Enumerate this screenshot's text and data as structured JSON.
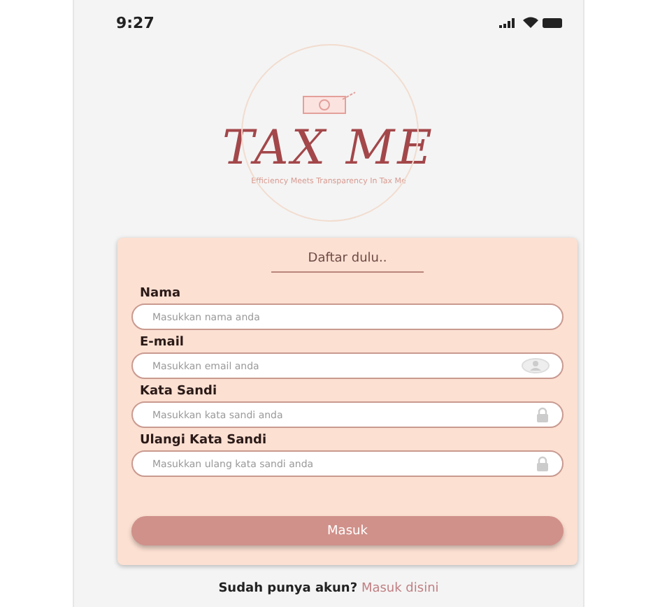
{
  "status_bar": {
    "time": "9:27"
  },
  "logo": {
    "title": "TAX ME",
    "tagline": "Efficiency Meets Transparency In Tax Me"
  },
  "form": {
    "heading": "Daftar dulu..",
    "fields": [
      {
        "label": "Nama",
        "placeholder": "Masukkan nama anda",
        "kind": "text"
      },
      {
        "label": "E-mail",
        "placeholder": "Masukkan email anda",
        "kind": "email"
      },
      {
        "label": "Kata Sandi",
        "placeholder": "Masukkan kata sandi anda",
        "kind": "password"
      },
      {
        "label": "Ulangi Kata Sandi",
        "placeholder": "Masukkan ulang kata sandi anda",
        "kind": "password"
      }
    ],
    "submit": "Masuk"
  },
  "footer": {
    "question": "Sudah punya akun?",
    "link": "Masuk disini"
  }
}
